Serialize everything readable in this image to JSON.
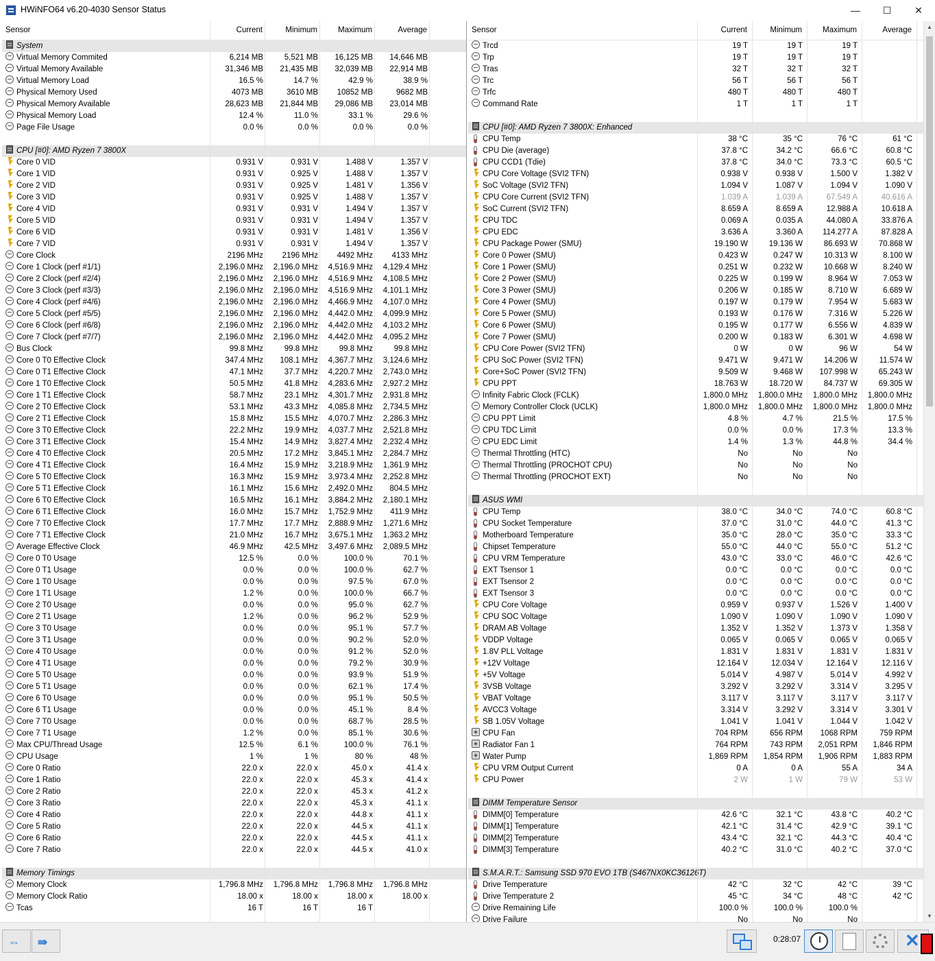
{
  "window": {
    "title": "HWiNFO64 v6.20-4030 Sensor Status",
    "min_glyph": "—",
    "max_glyph": "☐",
    "close_glyph": "✕"
  },
  "columns": {
    "sensor": "Sensor",
    "current": "Current",
    "minimum": "Minimum",
    "maximum": "Maximum",
    "average": "Average"
  },
  "left_rows": [
    [
      "g",
      "System"
    ],
    [
      "c",
      "Virtual Memory Commited",
      "6,214 MB",
      "5,521 MB",
      "16,125 MB",
      "14,646 MB"
    ],
    [
      "c",
      "Virtual Memory Available",
      "31,346 MB",
      "21,435 MB",
      "32,039 MB",
      "22,914 MB"
    ],
    [
      "c",
      "Virtual Memory Load",
      "16.5 %",
      "14.7 %",
      "42.9 %",
      "38.9 %"
    ],
    [
      "c",
      "Physical Memory Used",
      "4073 MB",
      "3610 MB",
      "10852 MB",
      "9682 MB"
    ],
    [
      "c",
      "Physical Memory Available",
      "28,623 MB",
      "21,844 MB",
      "29,086 MB",
      "23,014 MB"
    ],
    [
      "c",
      "Physical Memory Load",
      "12.4 %",
      "11.0 %",
      "33.1 %",
      "29.6 %"
    ],
    [
      "c",
      "Page File Usage",
      "0.0 %",
      "0.0 %",
      "0.0 %",
      "0.0 %"
    ],
    [
      "e"
    ],
    [
      "g",
      "CPU [#0]: AMD Ryzen 7 3800X"
    ],
    [
      "v",
      "Core 0 VID",
      "0.931 V",
      "0.931 V",
      "1.488 V",
      "1.357 V"
    ],
    [
      "v",
      "Core 1 VID",
      "0.931 V",
      "0.925 V",
      "1.488 V",
      "1.357 V"
    ],
    [
      "v",
      "Core 2 VID",
      "0.931 V",
      "0.925 V",
      "1.481 V",
      "1.356 V"
    ],
    [
      "v",
      "Core 3 VID",
      "0.931 V",
      "0.925 V",
      "1.488 V",
      "1.357 V"
    ],
    [
      "v",
      "Core 4 VID",
      "0.931 V",
      "0.931 V",
      "1.494 V",
      "1.357 V"
    ],
    [
      "v",
      "Core 5 VID",
      "0.931 V",
      "0.931 V",
      "1.494 V",
      "1.357 V"
    ],
    [
      "v",
      "Core 6 VID",
      "0.931 V",
      "0.931 V",
      "1.481 V",
      "1.356 V"
    ],
    [
      "v",
      "Core 7 VID",
      "0.931 V",
      "0.931 V",
      "1.494 V",
      "1.357 V"
    ],
    [
      "c",
      "Core Clock",
      "2196 MHz",
      "2196 MHz",
      "4492 MHz",
      "4133 MHz"
    ],
    [
      "c",
      "Core 1 Clock (perf #1/1)",
      "2,196.0 MHz",
      "2,196.0 MHz",
      "4,516.9 MHz",
      "4,129.4 MHz"
    ],
    [
      "c",
      "Core 2 Clock (perf #2/4)",
      "2,196.0 MHz",
      "2,196.0 MHz",
      "4,516.9 MHz",
      "4,108.5 MHz"
    ],
    [
      "c",
      "Core 3 Clock (perf #3/3)",
      "2,196.0 MHz",
      "2,196.0 MHz",
      "4,516.9 MHz",
      "4,101.1 MHz"
    ],
    [
      "c",
      "Core 4 Clock (perf #4/6)",
      "2,196.0 MHz",
      "2,196.0 MHz",
      "4,466.9 MHz",
      "4,107.0 MHz"
    ],
    [
      "c",
      "Core 5 Clock (perf #5/5)",
      "2,196.0 MHz",
      "2,196.0 MHz",
      "4,442.0 MHz",
      "4,099.9 MHz"
    ],
    [
      "c",
      "Core 6 Clock (perf #6/8)",
      "2,196.0 MHz",
      "2,196.0 MHz",
      "4,442.0 MHz",
      "4,103.2 MHz"
    ],
    [
      "c",
      "Core 7 Clock (perf #7/7)",
      "2,196.0 MHz",
      "2,196.0 MHz",
      "4,442.0 MHz",
      "4,095.2 MHz"
    ],
    [
      "c",
      "Bus Clock",
      "99.8 MHz",
      "99.8 MHz",
      "99.8 MHz",
      "99.8 MHz"
    ],
    [
      "c",
      "Core 0 T0 Effective Clock",
      "347.4 MHz",
      "108.1 MHz",
      "4,367.7 MHz",
      "3,124.6 MHz"
    ],
    [
      "c",
      "Core 0 T1 Effective Clock",
      "47.1 MHz",
      "37.7 MHz",
      "4,220.7 MHz",
      "2,743.0 MHz"
    ],
    [
      "c",
      "Core 1 T0 Effective Clock",
      "50.5 MHz",
      "41.8 MHz",
      "4,283.6 MHz",
      "2,927.2 MHz"
    ],
    [
      "c",
      "Core 1 T1 Effective Clock",
      "58.7 MHz",
      "23.1 MHz",
      "4,301.7 MHz",
      "2,931.8 MHz"
    ],
    [
      "c",
      "Core 2 T0 Effective Clock",
      "53.1 MHz",
      "43.3 MHz",
      "4,085.8 MHz",
      "2,734.5 MHz"
    ],
    [
      "c",
      "Core 2 T1 Effective Clock",
      "15.8 MHz",
      "15.5 MHz",
      "4,070.7 MHz",
      "2,286.3 MHz"
    ],
    [
      "c",
      "Core 3 T0 Effective Clock",
      "22.2 MHz",
      "19.9 MHz",
      "4,037.7 MHz",
      "2,521.8 MHz"
    ],
    [
      "c",
      "Core 3 T1 Effective Clock",
      "15.4 MHz",
      "14.9 MHz",
      "3,827.4 MHz",
      "2,232.4 MHz"
    ],
    [
      "c",
      "Core 4 T0 Effective Clock",
      "20.5 MHz",
      "17.2 MHz",
      "3,845.1 MHz",
      "2,284.7 MHz"
    ],
    [
      "c",
      "Core 4 T1 Effective Clock",
      "16.4 MHz",
      "15.9 MHz",
      "3,218.9 MHz",
      "1,361.9 MHz"
    ],
    [
      "c",
      "Core 5 T0 Effective Clock",
      "16.3 MHz",
      "15.9 MHz",
      "3,973.4 MHz",
      "2,252.8 MHz"
    ],
    [
      "c",
      "Core 5 T1 Effective Clock",
      "16.1 MHz",
      "15.6 MHz",
      "2,492.0 MHz",
      "804.5 MHz"
    ],
    [
      "c",
      "Core 6 T0 Effective Clock",
      "16.5 MHz",
      "16.1 MHz",
      "3,884.2 MHz",
      "2,180.1 MHz"
    ],
    [
      "c",
      "Core 6 T1 Effective Clock",
      "16.0 MHz",
      "15.7 MHz",
      "1,752.9 MHz",
      "411.9 MHz"
    ],
    [
      "c",
      "Core 7 T0 Effective Clock",
      "17.7 MHz",
      "17.7 MHz",
      "2,888.9 MHz",
      "1,271.6 MHz"
    ],
    [
      "c",
      "Core 7 T1 Effective Clock",
      "21.0 MHz",
      "16.7 MHz",
      "3,675.1 MHz",
      "1,363.2 MHz"
    ],
    [
      "c",
      "Average Effective Clock",
      "46.9 MHz",
      "42.5 MHz",
      "3,497.6 MHz",
      "2,089.5 MHz"
    ],
    [
      "c",
      "Core 0 T0 Usage",
      "12.5 %",
      "0.0 %",
      "100.0 %",
      "70.1 %"
    ],
    [
      "c",
      "Core 0 T1 Usage",
      "0.0 %",
      "0.0 %",
      "100.0 %",
      "62.7 %"
    ],
    [
      "c",
      "Core 1 T0 Usage",
      "0.0 %",
      "0.0 %",
      "97.5 %",
      "67.0 %"
    ],
    [
      "c",
      "Core 1 T1 Usage",
      "1.2 %",
      "0.0 %",
      "100.0 %",
      "66.7 %"
    ],
    [
      "c",
      "Core 2 T0 Usage",
      "0.0 %",
      "0.0 %",
      "95.0 %",
      "62.7 %"
    ],
    [
      "c",
      "Core 2 T1 Usage",
      "1.2 %",
      "0.0 %",
      "96.2 %",
      "52.9 %"
    ],
    [
      "c",
      "Core 3 T0 Usage",
      "0.0 %",
      "0.0 %",
      "95.1 %",
      "57.7 %"
    ],
    [
      "c",
      "Core 3 T1 Usage",
      "0.0 %",
      "0.0 %",
      "90.2 %",
      "52.0 %"
    ],
    [
      "c",
      "Core 4 T0 Usage",
      "0.0 %",
      "0.0 %",
      "91.2 %",
      "52.0 %"
    ],
    [
      "c",
      "Core 4 T1 Usage",
      "0.0 %",
      "0.0 %",
      "79.2 %",
      "30.9 %"
    ],
    [
      "c",
      "Core 5 T0 Usage",
      "0.0 %",
      "0.0 %",
      "93.9 %",
      "51.9 %"
    ],
    [
      "c",
      "Core 5 T1 Usage",
      "0.0 %",
      "0.0 %",
      "62.1 %",
      "17.4 %"
    ],
    [
      "c",
      "Core 6 T0 Usage",
      "0.0 %",
      "0.0 %",
      "95.1 %",
      "50.5 %"
    ],
    [
      "c",
      "Core 6 T1 Usage",
      "0.0 %",
      "0.0 %",
      "45.1 %",
      "8.4 %"
    ],
    [
      "c",
      "Core 7 T0 Usage",
      "0.0 %",
      "0.0 %",
      "68.7 %",
      "28.5 %"
    ],
    [
      "c",
      "Core 7 T1 Usage",
      "1.2 %",
      "0.0 %",
      "85.1 %",
      "30.6 %"
    ],
    [
      "c",
      "Max CPU/Thread Usage",
      "12.5 %",
      "6.1 %",
      "100.0 %",
      "76.1 %"
    ],
    [
      "c",
      "CPU Usage",
      "1 %",
      "1 %",
      "80 %",
      "48 %"
    ],
    [
      "c",
      "Core 0 Ratio",
      "22.0 x",
      "22.0 x",
      "45.0 x",
      "41.4 x"
    ],
    [
      "c",
      "Core 1 Ratio",
      "22.0 x",
      "22.0 x",
      "45.3 x",
      "41.4 x"
    ],
    [
      "c",
      "Core 2 Ratio",
      "22.0 x",
      "22.0 x",
      "45.3 x",
      "41.2 x"
    ],
    [
      "c",
      "Core 3 Ratio",
      "22.0 x",
      "22.0 x",
      "45.3 x",
      "41.1 x"
    ],
    [
      "c",
      "Core 4 Ratio",
      "22.0 x",
      "22.0 x",
      "44.8 x",
      "41.1 x"
    ],
    [
      "c",
      "Core 5 Ratio",
      "22.0 x",
      "22.0 x",
      "44.5 x",
      "41.1 x"
    ],
    [
      "c",
      "Core 6 Ratio",
      "22.0 x",
      "22.0 x",
      "44.5 x",
      "41.1 x"
    ],
    [
      "c",
      "Core 7 Ratio",
      "22.0 x",
      "22.0 x",
      "44.5 x",
      "41.0 x"
    ],
    [
      "e"
    ],
    [
      "g",
      "Memory Timings"
    ],
    [
      "c",
      "Memory Clock",
      "1,796.8 MHz",
      "1,796.8 MHz",
      "1,796.8 MHz",
      "1,796.8 MHz"
    ],
    [
      "c",
      "Memory Clock Ratio",
      "18.00 x",
      "18.00 x",
      "18.00 x",
      "18.00 x"
    ],
    [
      "c",
      "Tcas",
      "16 T",
      "16 T",
      "16 T",
      ""
    ]
  ],
  "right_rows": [
    [
      "c",
      "Trcd",
      "19 T",
      "19 T",
      "19 T",
      ""
    ],
    [
      "c",
      "Trp",
      "19 T",
      "19 T",
      "19 T",
      ""
    ],
    [
      "c",
      "Tras",
      "32 T",
      "32 T",
      "32 T",
      ""
    ],
    [
      "c",
      "Trc",
      "56 T",
      "56 T",
      "56 T",
      ""
    ],
    [
      "c",
      "Trfc",
      "480 T",
      "480 T",
      "480 T",
      ""
    ],
    [
      "c",
      "Command Rate",
      "1 T",
      "1 T",
      "1 T",
      ""
    ],
    [
      "e"
    ],
    [
      "g",
      "CPU [#0]: AMD Ryzen 7 3800X: Enhanced"
    ],
    [
      "t",
      "CPU Temp",
      "38 °C",
      "35 °C",
      "76 °C",
      "61 °C"
    ],
    [
      "t",
      "CPU Die (average)",
      "37.8 °C",
      "34.2 °C",
      "66.6 °C",
      "60.8 °C"
    ],
    [
      "t",
      "CPU CCD1 (Tdie)",
      "37.8 °C",
      "34.0 °C",
      "73.3 °C",
      "60.5 °C"
    ],
    [
      "v",
      "CPU Core Voltage (SVI2 TFN)",
      "0.938 V",
      "0.938 V",
      "1.500 V",
      "1.382 V"
    ],
    [
      "v",
      "SoC Voltage (SVI2 TFN)",
      "1.094 V",
      "1.087 V",
      "1.094 V",
      "1.090 V"
    ],
    [
      "v",
      "CPU Core Current (SVI2 TFN)",
      "1.039 A",
      "1.039 A",
      "67.549 A",
      "40.616 A",
      "gray"
    ],
    [
      "v",
      "SoC Current (SVI2 TFN)",
      "8.659 A",
      "8.659 A",
      "12.988 A",
      "10.618 A"
    ],
    [
      "v",
      "CPU TDC",
      "0.069 A",
      "0.035 A",
      "44.080 A",
      "33.876 A"
    ],
    [
      "v",
      "CPU EDC",
      "3.636 A",
      "3.360 A",
      "114.277 A",
      "87.828 A"
    ],
    [
      "v",
      "CPU Package Power (SMU)",
      "19.190 W",
      "19.136 W",
      "86.693 W",
      "70.868 W"
    ],
    [
      "v",
      "Core 0 Power (SMU)",
      "0.423 W",
      "0.247 W",
      "10.313 W",
      "8.100 W"
    ],
    [
      "v",
      "Core 1 Power (SMU)",
      "0.251 W",
      "0.232 W",
      "10.668 W",
      "8.240 W"
    ],
    [
      "v",
      "Core 2 Power (SMU)",
      "0.225 W",
      "0.199 W",
      "8.964 W",
      "7.053 W"
    ],
    [
      "v",
      "Core 3 Power (SMU)",
      "0.206 W",
      "0.185 W",
      "8.710 W",
      "6.689 W"
    ],
    [
      "v",
      "Core 4 Power (SMU)",
      "0.197 W",
      "0.179 W",
      "7.954 W",
      "5.683 W"
    ],
    [
      "v",
      "Core 5 Power (SMU)",
      "0.193 W",
      "0.176 W",
      "7.316 W",
      "5.226 W"
    ],
    [
      "v",
      "Core 6 Power (SMU)",
      "0.195 W",
      "0.177 W",
      "6.556 W",
      "4.839 W"
    ],
    [
      "v",
      "Core 7 Power (SMU)",
      "0.200 W",
      "0.183 W",
      "6.301 W",
      "4.698 W"
    ],
    [
      "v",
      "CPU Core Power (SVI2 TFN)",
      "0 W",
      "0 W",
      "96 W",
      "54 W"
    ],
    [
      "v",
      "CPU SoC Power (SVI2 TFN)",
      "9.471 W",
      "9.471 W",
      "14.206 W",
      "11.574 W"
    ],
    [
      "v",
      "Core+SoC Power (SVI2 TFN)",
      "9.509 W",
      "9.468 W",
      "107.998 W",
      "65.243 W"
    ],
    [
      "v",
      "CPU PPT",
      "18.763 W",
      "18.720 W",
      "84.737 W",
      "69.305 W"
    ],
    [
      "c",
      "Infinity Fabric Clock (FCLK)",
      "1,800.0 MHz",
      "1,800.0 MHz",
      "1,800.0 MHz",
      "1,800.0 MHz"
    ],
    [
      "c",
      "Memory Controller Clock (UCLK)",
      "1,800.0 MHz",
      "1,800.0 MHz",
      "1,800.0 MHz",
      "1,800.0 MHz"
    ],
    [
      "c",
      "CPU PPT Limit",
      "4.8 %",
      "4.7 %",
      "21.5 %",
      "17.5 %"
    ],
    [
      "c",
      "CPU TDC Limit",
      "0.0 %",
      "0.0 %",
      "17.3 %",
      "13.3 %"
    ],
    [
      "c",
      "CPU EDC Limit",
      "1.4 %",
      "1.3 %",
      "44.8 %",
      "34.4 %"
    ],
    [
      "c",
      "Thermal Throttling (HTC)",
      "No",
      "No",
      "No",
      ""
    ],
    [
      "c",
      "Thermal Throttling (PROCHOT CPU)",
      "No",
      "No",
      "No",
      ""
    ],
    [
      "c",
      "Thermal Throttling (PROCHOT EXT)",
      "No",
      "No",
      "No",
      ""
    ],
    [
      "e"
    ],
    [
      "g",
      "ASUS WMI"
    ],
    [
      "t",
      "CPU Temp",
      "38.0 °C",
      "34.0 °C",
      "74.0 °C",
      "60.8 °C"
    ],
    [
      "t",
      "CPU Socket Temperature",
      "37.0 °C",
      "31.0 °C",
      "44.0 °C",
      "41.3 °C"
    ],
    [
      "t",
      "Motherboard Temperature",
      "35.0 °C",
      "28.0 °C",
      "35.0 °C",
      "33.3 °C"
    ],
    [
      "t",
      "Chipset Temperature",
      "55.0 °C",
      "44.0 °C",
      "55.0 °C",
      "51.2 °C"
    ],
    [
      "t",
      "CPU VRM Temperature",
      "43.0 °C",
      "33.0 °C",
      "46.0 °C",
      "42.6 °C"
    ],
    [
      "t",
      "EXT Tsensor 1",
      "0.0 °C",
      "0.0 °C",
      "0.0 °C",
      "0.0 °C"
    ],
    [
      "t",
      "EXT Tsensor 2",
      "0.0 °C",
      "0.0 °C",
      "0.0 °C",
      "0.0 °C"
    ],
    [
      "t",
      "EXT Tsensor 3",
      "0.0 °C",
      "0.0 °C",
      "0.0 °C",
      "0.0 °C"
    ],
    [
      "v",
      "CPU Core Voltage",
      "0.959 V",
      "0.937 V",
      "1.526 V",
      "1.400 V"
    ],
    [
      "v",
      "CPU SOC Voltage",
      "1.090 V",
      "1.090 V",
      "1.090 V",
      "1.090 V"
    ],
    [
      "v",
      "DRAM AB Voltage",
      "1.352 V",
      "1.352 V",
      "1.373 V",
      "1.358 V"
    ],
    [
      "v",
      "VDDP Voltage",
      "0.065 V",
      "0.065 V",
      "0.065 V",
      "0.065 V"
    ],
    [
      "v",
      "1.8V PLL Voltage",
      "1.831 V",
      "1.831 V",
      "1.831 V",
      "1.831 V"
    ],
    [
      "v",
      "+12V Voltage",
      "12.164 V",
      "12.034 V",
      "12.164 V",
      "12.116 V"
    ],
    [
      "v",
      "+5V Voltage",
      "5.014 V",
      "4.987 V",
      "5.014 V",
      "4.992 V"
    ],
    [
      "v",
      "3VSB Voltage",
      "3.292 V",
      "3.292 V",
      "3.314 V",
      "3.295 V"
    ],
    [
      "v",
      "VBAT Voltage",
      "3.117 V",
      "3.117 V",
      "3.117 V",
      "3.117 V"
    ],
    [
      "v",
      "AVCC3 Voltage",
      "3.314 V",
      "3.292 V",
      "3.314 V",
      "3.301 V"
    ],
    [
      "v",
      "SB 1.05V Voltage",
      "1.041 V",
      "1.041 V",
      "1.044 V",
      "1.042 V"
    ],
    [
      "f",
      "CPU Fan",
      "704 RPM",
      "656 RPM",
      "1068 RPM",
      "759 RPM"
    ],
    [
      "f",
      "Radiator Fan 1",
      "764 RPM",
      "743 RPM",
      "2,051 RPM",
      "1,846 RPM"
    ],
    [
      "f",
      "Water Pump",
      "1,869 RPM",
      "1,854 RPM",
      "1,906 RPM",
      "1,883 RPM"
    ],
    [
      "v",
      "CPU VRM Output Current",
      "0 A",
      "0 A",
      "55 A",
      "34 A"
    ],
    [
      "v",
      "CPU Power",
      "2 W",
      "1 W",
      "79 W",
      "53 W",
      "gray"
    ],
    [
      "e"
    ],
    [
      "g",
      "DIMM Temperature Sensor"
    ],
    [
      "t",
      "DIMM[0] Temperature",
      "42.6 °C",
      "32.1 °C",
      "43.8 °C",
      "40.2 °C"
    ],
    [
      "t",
      "DIMM[1] Temperature",
      "42.1 °C",
      "31.4 °C",
      "42.9 °C",
      "39.1 °C"
    ],
    [
      "t",
      "DIMM[2] Temperature",
      "43.4 °C",
      "32.1 °C",
      "44.3 °C",
      "40.4 °C"
    ],
    [
      "t",
      "DIMM[3] Temperature",
      "40.2 °C",
      "31.0 °C",
      "40.2 °C",
      "37.0 °C"
    ],
    [
      "e"
    ],
    [
      "g",
      "S.M.A.R.T.: Samsung SSD 970 EVO 1TB (S467NX0KC36126T)"
    ],
    [
      "t",
      "Drive Temperature",
      "42 °C",
      "32 °C",
      "42 °C",
      "39 °C"
    ],
    [
      "t",
      "Drive Temperature 2",
      "45 °C",
      "34 °C",
      "48 °C",
      "42 °C"
    ],
    [
      "c",
      "Drive Remaining Life",
      "100.0 %",
      "100.0 %",
      "100.0 %",
      ""
    ],
    [
      "c",
      "Drive Failure",
      "No",
      "No",
      "No",
      ""
    ]
  ],
  "statusbar": {
    "timer": "0:28:07",
    "nav_left_glyph": "⇔",
    "nav_right_glyph": "⇛"
  }
}
